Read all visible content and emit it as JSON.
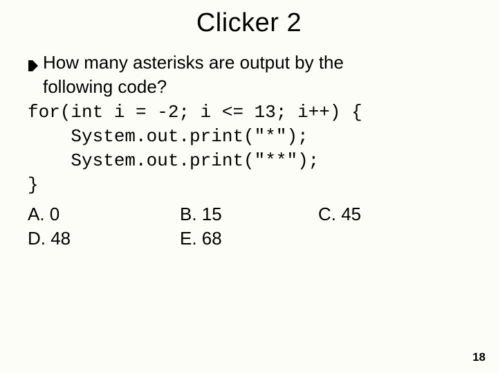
{
  "title": "Clicker 2",
  "question_line1": "How many asterisks are output by the",
  "question_line2": "following code?",
  "code_line1": "for(int i = -2; i <= 13; i++) {",
  "code_line2": "    System.out.print(\"*\");",
  "code_line3": "    System.out.print(\"**\");",
  "code_line4": "}",
  "answers": {
    "a": "A. 0",
    "b": "B.  15",
    "c": "C. 45",
    "d": "D. 48",
    "e": "E.  68"
  },
  "page_number": "18"
}
